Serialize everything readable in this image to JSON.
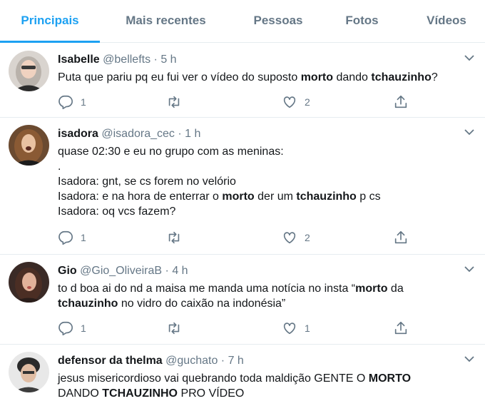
{
  "tabs": [
    {
      "label": "Principais",
      "active": true
    },
    {
      "label": "Mais recentes",
      "active": false
    },
    {
      "label": "Pessoas",
      "active": false
    },
    {
      "label": "Fotos",
      "active": false
    },
    {
      "label": "Vídeos",
      "active": false
    }
  ],
  "colors": {
    "accent": "#1da1f2",
    "text": "#14171a",
    "muted": "#657786",
    "border": "#e6ecf0"
  },
  "tweets": [
    {
      "name": "Isabelle",
      "handle": "@bellefts",
      "sep": "·",
      "time": "5 h",
      "lines": [
        [
          {
            "t": "Puta que pariu pq eu fui ver o vídeo do suposto "
          },
          {
            "t": "morto",
            "b": true
          },
          {
            "t": " dando "
          },
          {
            "t": "tchauzinho",
            "b": true
          },
          {
            "t": "?"
          }
        ]
      ],
      "replies": "1",
      "retweets": "",
      "likes": "2"
    },
    {
      "name": "isadora",
      "handle": "@isadora_cec",
      "sep": "·",
      "time": "1 h",
      "lines": [
        [
          {
            "t": "quase 02:30 e eu no grupo com as meninas:"
          }
        ],
        [
          {
            "t": "."
          }
        ],
        [
          {
            "t": "Isadora: gnt, se cs forem no velório"
          }
        ],
        [
          {
            "t": "Isadora: e na hora de enterrar o "
          },
          {
            "t": "morto",
            "b": true
          },
          {
            "t": " der um "
          },
          {
            "t": "tchauzinho",
            "b": true
          },
          {
            "t": " p cs"
          }
        ],
        [
          {
            "t": "Isadora: oq vcs fazem?"
          }
        ]
      ],
      "replies": "1",
      "retweets": "",
      "likes": "2"
    },
    {
      "name": "Gio",
      "handle": "@Gio_OliveiraB",
      "sep": "·",
      "time": "4 h",
      "lines": [
        [
          {
            "t": "to d boa ai do nd a maisa me manda uma notícia no insta “"
          },
          {
            "t": "morto",
            "b": true
          },
          {
            "t": " da"
          }
        ],
        [
          {
            "t": "tchauzinho",
            "b": true
          },
          {
            "t": " no vidro do caixão na indonésia”"
          }
        ]
      ],
      "replies": "1",
      "retweets": "",
      "likes": "1"
    },
    {
      "name": "defensor da thelma",
      "handle": "@guchato",
      "sep": "·",
      "time": "7 h",
      "lines": [
        [
          {
            "t": "jesus misericordioso vai quebrando toda maldição GENTE O "
          },
          {
            "t": "MORTO",
            "b": true
          }
        ],
        [
          {
            "t": "DANDO "
          },
          {
            "t": "TCHAUZINHO",
            "b": true
          },
          {
            "t": " PRO VÍDEO"
          }
        ]
      ]
    }
  ]
}
